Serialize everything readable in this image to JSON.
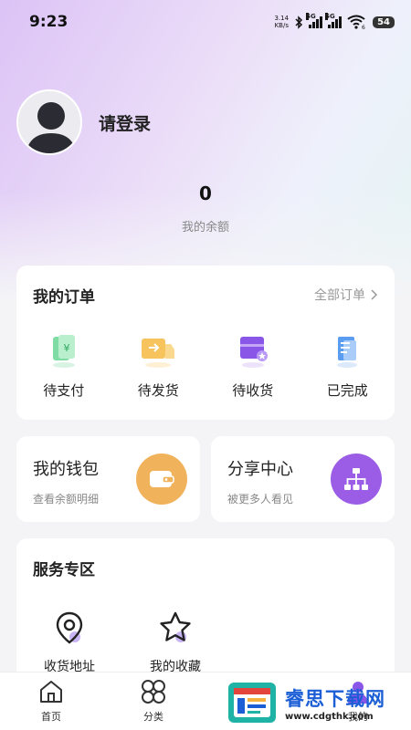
{
  "status_bar": {
    "time": "9:23",
    "net_speed_value": "3.14",
    "net_speed_unit": "KB/s",
    "signal1_tag": "5G",
    "signal2_tag": "5G",
    "wifi_tag": "6",
    "battery": "54"
  },
  "profile": {
    "login_label": "请登录"
  },
  "balance": {
    "value": "0",
    "label": "我的余额"
  },
  "orders": {
    "title": "我的订单",
    "all_label": "全部订单",
    "items": [
      {
        "label": "待支付",
        "icon": "payment-icon"
      },
      {
        "label": "待发货",
        "icon": "truck-icon"
      },
      {
        "label": "待收货",
        "icon": "package-icon"
      },
      {
        "label": "已完成",
        "icon": "document-icon"
      }
    ]
  },
  "wallet": {
    "title": "我的钱包",
    "subtitle": "查看余额明细",
    "icon": "wallet-icon",
    "color": "#f0b25a"
  },
  "share": {
    "title": "分享中心",
    "subtitle": "被更多人看见",
    "icon": "network-icon",
    "color": "#9b5de5"
  },
  "services": {
    "title": "服务专区",
    "items": [
      {
        "label": "收货地址",
        "icon": "location-icon"
      },
      {
        "label": "我的收藏",
        "icon": "star-icon"
      }
    ]
  },
  "tabbar": {
    "items": [
      {
        "label": "首页",
        "icon": "home-icon"
      },
      {
        "label": "分类",
        "icon": "category-icon"
      },
      {
        "label": "",
        "icon": ""
      },
      {
        "label": "我的",
        "icon": "user-icon"
      }
    ]
  },
  "watermark": {
    "cn_text": "睿思下载网",
    "url": "www.cdgthk.com"
  },
  "colors": {
    "accent_purple": "#9b5de5",
    "accent_orange": "#f0b25a",
    "watermark_blue": "#1b5ed6"
  }
}
